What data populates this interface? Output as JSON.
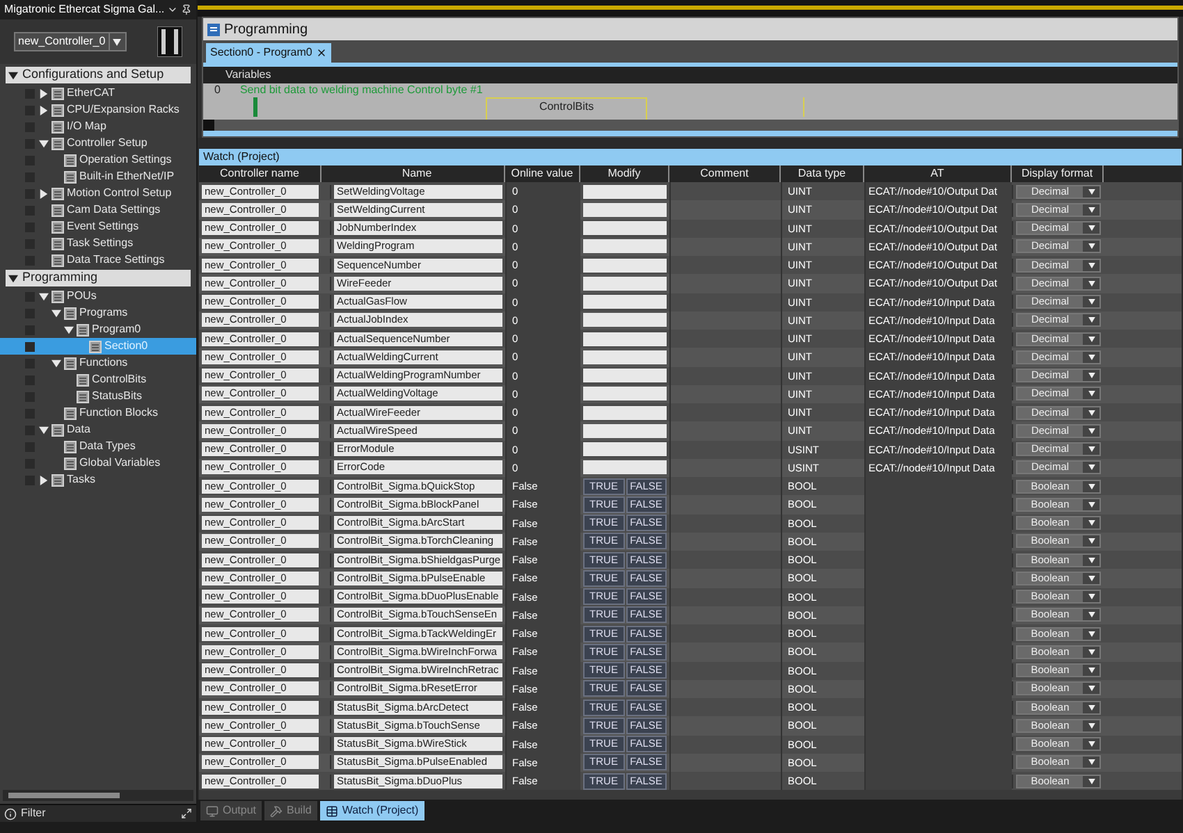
{
  "window": {
    "title": "Migatronic Ethercat Sigma Gal..."
  },
  "controller_select": {
    "value": "new_Controller_0"
  },
  "sidebar": {
    "sections": [
      {
        "label": "Configurations and Setup",
        "expanded": true,
        "items": [
          {
            "label": "EtherCAT",
            "expanded": false,
            "selected": false
          },
          {
            "label": "CPU/Expansion Racks",
            "expanded": false,
            "selected": false
          },
          {
            "label": "I/O Map",
            "selected": false
          },
          {
            "label": "Controller Setup",
            "expanded": true,
            "selected": false,
            "children": [
              {
                "label": "Operation Settings",
                "selected": false
              },
              {
                "label": "Built-in EtherNet/IP",
                "selected": false
              }
            ]
          },
          {
            "label": "Motion Control Setup",
            "expanded": false,
            "selected": false
          },
          {
            "label": "Cam Data Settings",
            "selected": false
          },
          {
            "label": "Event Settings",
            "selected": false
          },
          {
            "label": "Task Settings",
            "selected": false
          },
          {
            "label": "Data Trace Settings",
            "selected": false
          }
        ]
      },
      {
        "label": "Programming",
        "expanded": true,
        "items": [
          {
            "label": "POUs",
            "expanded": true,
            "selected": false,
            "children": [
              {
                "label": "Programs",
                "expanded": true,
                "selected": false,
                "children": [
                  {
                    "label": "Program0",
                    "expanded": true,
                    "selected": false,
                    "children": [
                      {
                        "label": "Section0",
                        "selected": true
                      }
                    ]
                  }
                ]
              },
              {
                "label": "Functions",
                "expanded": true,
                "selected": false,
                "children": [
                  {
                    "label": "ControlBits",
                    "selected": false
                  },
                  {
                    "label": "StatusBits",
                    "selected": false
                  }
                ]
              },
              {
                "label": "Function Blocks",
                "selected": false
              }
            ]
          },
          {
            "label": "Data",
            "expanded": true,
            "selected": false,
            "children": [
              {
                "label": "Data Types",
                "selected": false
              },
              {
                "label": "Global Variables",
                "selected": false
              }
            ]
          },
          {
            "label": "Tasks",
            "expanded": false,
            "selected": false
          }
        ]
      }
    ],
    "filter": {
      "label": "Filter"
    }
  },
  "editor": {
    "title": "Programming",
    "tabs": [
      {
        "label": "Section0 - Program0",
        "selected": true
      }
    ],
    "variables_label": "Variables",
    "rung": {
      "number": "0",
      "comment": "Send bit data to welding machine Control byte #1",
      "block": "ControlBits"
    }
  },
  "watch": {
    "title": "Watch (Project)",
    "columns": [
      "Controller name",
      "Name",
      "Online value",
      "Modify",
      "Comment",
      "Data type",
      "AT",
      "Display format"
    ],
    "rows": [
      {
        "kind": "word",
        "controller": "new_Controller_0",
        "name": "SetWeldingVoltage",
        "online": "0",
        "data_type": "UINT",
        "at": "ECAT://node#10/Output Dat",
        "format": "Decimal"
      },
      {
        "kind": "word",
        "controller": "new_Controller_0",
        "name": "SetWeldingCurrent",
        "online": "0",
        "data_type": "UINT",
        "at": "ECAT://node#10/Output Dat",
        "format": "Decimal"
      },
      {
        "kind": "word",
        "controller": "new_Controller_0",
        "name": "JobNumberIndex",
        "online": "0",
        "data_type": "UINT",
        "at": "ECAT://node#10/Output Dat",
        "format": "Decimal"
      },
      {
        "kind": "word",
        "controller": "new_Controller_0",
        "name": "WeldingProgram",
        "online": "0",
        "data_type": "UINT",
        "at": "ECAT://node#10/Output Dat",
        "format": "Decimal"
      },
      {
        "kind": "word",
        "controller": "new_Controller_0",
        "name": "SequenceNumber",
        "online": "0",
        "data_type": "UINT",
        "at": "ECAT://node#10/Output Dat",
        "format": "Decimal"
      },
      {
        "kind": "word",
        "controller": "new_Controller_0",
        "name": "WireFeeder",
        "online": "0",
        "data_type": "UINT",
        "at": "ECAT://node#10/Output Dat",
        "format": "Decimal"
      },
      {
        "kind": "word",
        "controller": "new_Controller_0",
        "name": "ActualGasFlow",
        "online": "0",
        "data_type": "UINT",
        "at": "ECAT://node#10/Input Data",
        "format": "Decimal"
      },
      {
        "kind": "word",
        "controller": "new_Controller_0",
        "name": "ActualJobIndex",
        "online": "0",
        "data_type": "UINT",
        "at": "ECAT://node#10/Input Data",
        "format": "Decimal"
      },
      {
        "kind": "word",
        "controller": "new_Controller_0",
        "name": "ActualSequenceNumber",
        "online": "0",
        "data_type": "UINT",
        "at": "ECAT://node#10/Input Data",
        "format": "Decimal"
      },
      {
        "kind": "word",
        "controller": "new_Controller_0",
        "name": "ActualWeldingCurrent",
        "online": "0",
        "data_type": "UINT",
        "at": "ECAT://node#10/Input Data",
        "format": "Decimal"
      },
      {
        "kind": "word",
        "controller": "new_Controller_0",
        "name": "ActualWeldingProgramNumber",
        "online": "0",
        "data_type": "UINT",
        "at": "ECAT://node#10/Input Data",
        "format": "Decimal"
      },
      {
        "kind": "word",
        "controller": "new_Controller_0",
        "name": "ActualWeldingVoltage",
        "online": "0",
        "data_type": "UINT",
        "at": "ECAT://node#10/Input Data",
        "format": "Decimal"
      },
      {
        "kind": "word",
        "controller": "new_Controller_0",
        "name": "ActualWireFeeder",
        "online": "0",
        "data_type": "UINT",
        "at": "ECAT://node#10/Input Data",
        "format": "Decimal"
      },
      {
        "kind": "word",
        "controller": "new_Controller_0",
        "name": "ActualWireSpeed",
        "online": "0",
        "data_type": "UINT",
        "at": "ECAT://node#10/Input Data",
        "format": "Decimal"
      },
      {
        "kind": "word",
        "controller": "new_Controller_0",
        "name": "ErrorModule",
        "online": "0",
        "data_type": "USINT",
        "at": "ECAT://node#10/Input Data",
        "format": "Decimal"
      },
      {
        "kind": "word",
        "controller": "new_Controller_0",
        "name": "ErrorCode",
        "online": "0",
        "data_type": "USINT",
        "at": "ECAT://node#10/Input Data",
        "format": "Decimal"
      },
      {
        "kind": "bit",
        "controller": "new_Controller_0",
        "name": "ControlBit_Sigma.bQuickStop",
        "online": "False",
        "modify": [
          "TRUE",
          "FALSE"
        ],
        "data_type": "BOOL",
        "format": "Boolean"
      },
      {
        "kind": "bit",
        "controller": "new_Controller_0",
        "name": "ControlBit_Sigma.bBlockPanel",
        "online": "False",
        "modify": [
          "TRUE",
          "FALSE"
        ],
        "data_type": "BOOL",
        "format": "Boolean"
      },
      {
        "kind": "bit",
        "controller": "new_Controller_0",
        "name": "ControlBit_Sigma.bArcStart",
        "online": "False",
        "modify": [
          "TRUE",
          "FALSE"
        ],
        "data_type": "BOOL",
        "format": "Boolean"
      },
      {
        "kind": "bit",
        "controller": "new_Controller_0",
        "name": "ControlBit_Sigma.bTorchCleaning",
        "online": "False",
        "modify": [
          "TRUE",
          "FALSE"
        ],
        "data_type": "BOOL",
        "format": "Boolean"
      },
      {
        "kind": "bit",
        "controller": "new_Controller_0",
        "name": "ControlBit_Sigma.bShieldgasPurge",
        "online": "False",
        "modify": [
          "TRUE",
          "FALSE"
        ],
        "data_type": "BOOL",
        "format": "Boolean"
      },
      {
        "kind": "bit",
        "controller": "new_Controller_0",
        "name": "ControlBit_Sigma.bPulseEnable",
        "online": "False",
        "modify": [
          "TRUE",
          "FALSE"
        ],
        "data_type": "BOOL",
        "format": "Boolean"
      },
      {
        "kind": "bit",
        "controller": "new_Controller_0",
        "name": "ControlBit_Sigma.bDuoPlusEnable",
        "online": "False",
        "modify": [
          "TRUE",
          "FALSE"
        ],
        "data_type": "BOOL",
        "format": "Boolean"
      },
      {
        "kind": "bit",
        "controller": "new_Controller_0",
        "name": "ControlBit_Sigma.bTouchSenseEn",
        "online": "False",
        "modify": [
          "TRUE",
          "FALSE"
        ],
        "data_type": "BOOL",
        "format": "Boolean"
      },
      {
        "kind": "bit",
        "controller": "new_Controller_0",
        "name": "ControlBit_Sigma.bTackWeldingEr",
        "online": "False",
        "modify": [
          "TRUE",
          "FALSE"
        ],
        "data_type": "BOOL",
        "format": "Boolean"
      },
      {
        "kind": "bit",
        "controller": "new_Controller_0",
        "name": "ControlBit_Sigma.bWireInchForwa",
        "online": "False",
        "modify": [
          "TRUE",
          "FALSE"
        ],
        "data_type": "BOOL",
        "format": "Boolean"
      },
      {
        "kind": "bit",
        "controller": "new_Controller_0",
        "name": "ControlBit_Sigma.bWireInchRetrac",
        "online": "False",
        "modify": [
          "TRUE",
          "FALSE"
        ],
        "data_type": "BOOL",
        "format": "Boolean"
      },
      {
        "kind": "bit",
        "controller": "new_Controller_0",
        "name": "ControlBit_Sigma.bResetError",
        "online": "False",
        "modify": [
          "TRUE",
          "FALSE"
        ],
        "data_type": "BOOL",
        "format": "Boolean"
      },
      {
        "kind": "bit",
        "controller": "new_Controller_0",
        "name": "StatusBit_Sigma.bArcDetect",
        "online": "False",
        "modify": [
          "TRUE",
          "FALSE"
        ],
        "data_type": "BOOL",
        "format": "Boolean"
      },
      {
        "kind": "bit",
        "controller": "new_Controller_0",
        "name": "StatusBit_Sigma.bTouchSense",
        "online": "False",
        "modify": [
          "TRUE",
          "FALSE"
        ],
        "data_type": "BOOL",
        "format": "Boolean"
      },
      {
        "kind": "bit",
        "controller": "new_Controller_0",
        "name": "StatusBit_Sigma.bWireStick",
        "online": "False",
        "modify": [
          "TRUE",
          "FALSE"
        ],
        "data_type": "BOOL",
        "format": "Boolean"
      },
      {
        "kind": "bit",
        "controller": "new_Controller_0",
        "name": "StatusBit_Sigma.bPulseEnabled",
        "online": "False",
        "modify": [
          "TRUE",
          "FALSE"
        ],
        "data_type": "BOOL",
        "format": "Boolean"
      },
      {
        "kind": "bit",
        "controller": "new_Controller_0",
        "name": "StatusBit_Sigma.bDuoPlus",
        "online": "False",
        "modify": [
          "TRUE",
          "FALSE"
        ],
        "data_type": "BOOL",
        "format": "Boolean"
      }
    ]
  },
  "bottom_tabs": [
    {
      "label": "Output",
      "selected": false
    },
    {
      "label": "Build",
      "selected": false
    },
    {
      "label": "Watch (Project)",
      "selected": true
    }
  ]
}
